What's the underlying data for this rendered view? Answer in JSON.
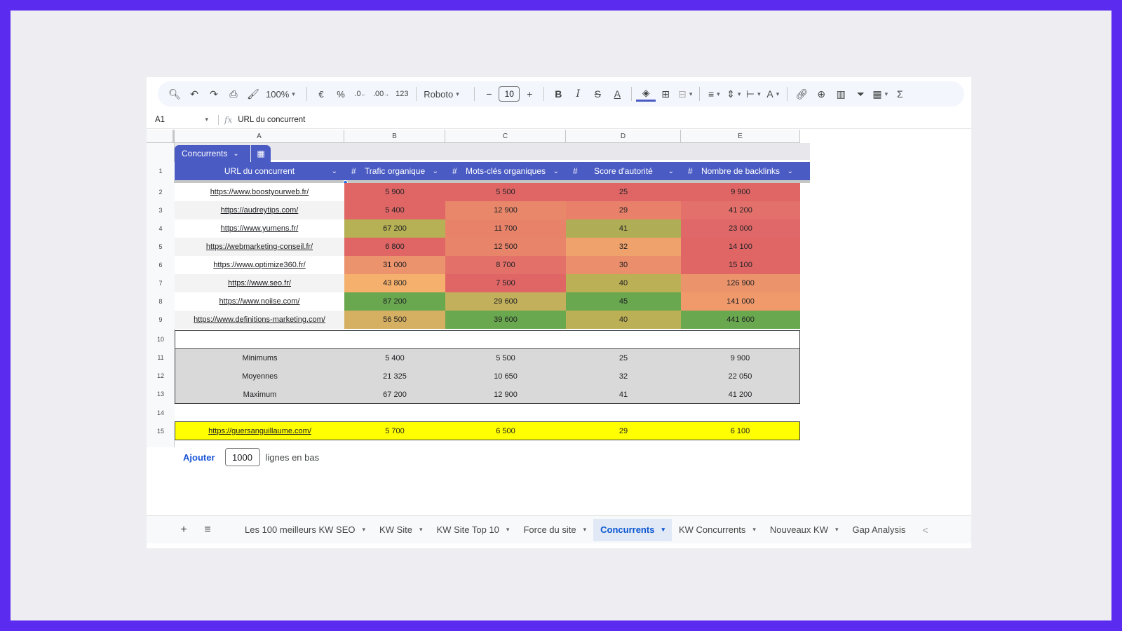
{
  "toolbar": {
    "zoom": "100%",
    "currency": "€",
    "percent": "%",
    "dec_less": ".0←",
    "dec_more": ".00",
    "number_format": "123",
    "font": "Roboto",
    "font_size": "10",
    "bold": "B",
    "italic": "I",
    "strike": "S",
    "text_color": "A",
    "sum": "Σ"
  },
  "formula_bar": {
    "cell_ref": "A1",
    "fx": "fx",
    "content": "URL du concurrent"
  },
  "columns": [
    "A",
    "B",
    "C",
    "D",
    "E"
  ],
  "row_numbers": [
    "1",
    "2",
    "3",
    "4",
    "5",
    "6",
    "7",
    "8",
    "9",
    "10",
    "11",
    "12",
    "13",
    "14",
    "15"
  ],
  "table": {
    "name": "Concurrents",
    "headers": [
      {
        "label": "URL du concurrent",
        "hash": ""
      },
      {
        "label": "Trafic organique",
        "hash": "#"
      },
      {
        "label": "Mots-clés organiques",
        "hash": "#"
      },
      {
        "label": "Score d'autorité",
        "hash": "#"
      },
      {
        "label": "Nombre de backlinks",
        "hash": "#"
      }
    ],
    "rows": [
      {
        "url": "https://www.boostyourweb.fr/",
        "trafic": "5 900",
        "mots": "5 500",
        "score": "25",
        "backlinks": "9 900",
        "colors": [
          "#ffffff",
          "#e06666",
          "#e06666",
          "#e06666",
          "#e06666"
        ]
      },
      {
        "url": "https://audreytips.com/",
        "trafic": "5 400",
        "mots": "12 900",
        "score": "29",
        "backlinks": "41 200",
        "colors": [
          "#f3f3f3",
          "#e06666",
          "#e8876a",
          "#e8806a",
          "#e3706a"
        ]
      },
      {
        "url": "https://www.yumens.fr/",
        "trafic": "67 200",
        "mots": "11 700",
        "score": "41",
        "backlinks": "23 000",
        "colors": [
          "#ffffff",
          "#b5b154",
          "#e8836a",
          "#b0ad57",
          "#e06868"
        ]
      },
      {
        "url": "https://webmarketing-conseil.fr/",
        "trafic": "6 800",
        "mots": "12 500",
        "score": "32",
        "backlinks": "14 100",
        "colors": [
          "#f3f3f3",
          "#e06666",
          "#e8846a",
          "#efa26b",
          "#e06666"
        ]
      },
      {
        "url": "https://www.optimize360.fr/",
        "trafic": "31 000",
        "mots": "8 700",
        "score": "30",
        "backlinks": "15 100",
        "colors": [
          "#ffffff",
          "#eb936c",
          "#e3716a",
          "#eb8e6b",
          "#e06666"
        ]
      },
      {
        "url": "https://www.seo.fr/",
        "trafic": "43 800",
        "mots": "7 500",
        "score": "40",
        "backlinks": "126 900",
        "colors": [
          "#f3f3f3",
          "#f4b06c",
          "#e06666",
          "#bcb057",
          "#eb946b"
        ]
      },
      {
        "url": "https://www.noiise.com/",
        "trafic": "87 200",
        "mots": "29 600",
        "score": "45",
        "backlinks": "141 000",
        "colors": [
          "#ffffff",
          "#6aa84f",
          "#c3b05c",
          "#6aa84f",
          "#f09a6b"
        ]
      },
      {
        "url": "https://www.definitions-marketing.com/",
        "trafic": "56 500",
        "mots": "39 600",
        "score": "40",
        "backlinks": "441 600",
        "colors": [
          "#f3f3f3",
          "#d5af62",
          "#6aa84f",
          "#bcb057",
          "#6aa84f"
        ]
      }
    ]
  },
  "summary": [
    {
      "label": "Minimums",
      "b": "5 400",
      "c": "5 500",
      "d": "25",
      "e": "9 900"
    },
    {
      "label": "Moyennes",
      "b": "21 325",
      "c": "10 650",
      "d": "32",
      "e": "22 050"
    },
    {
      "label": "Maximum",
      "b": "67 200",
      "c": "12 900",
      "d": "41",
      "e": "41 200"
    }
  ],
  "own_site": {
    "url": "https://guersanguillaume.com/",
    "b": "5 700",
    "c": "6 500",
    "d": "29",
    "e": "6 100"
  },
  "add_rows": {
    "link": "Ajouter",
    "count": "1000",
    "suffix": "lignes en bas"
  },
  "tabs": {
    "add": "+",
    "all_sheets": "≡",
    "items": [
      {
        "label": "Les 100 meilleurs KW SEO",
        "active": false
      },
      {
        "label": "KW Site",
        "active": false
      },
      {
        "label": "KW Site Top 10",
        "active": false
      },
      {
        "label": "Force du site",
        "active": false
      },
      {
        "label": "Concurrents",
        "active": true
      },
      {
        "label": "KW Concurrents",
        "active": false
      },
      {
        "label": "Nouveaux KW",
        "active": false
      },
      {
        "label": "Gap Analysis",
        "active": false
      }
    ],
    "nav_prev": "<"
  }
}
